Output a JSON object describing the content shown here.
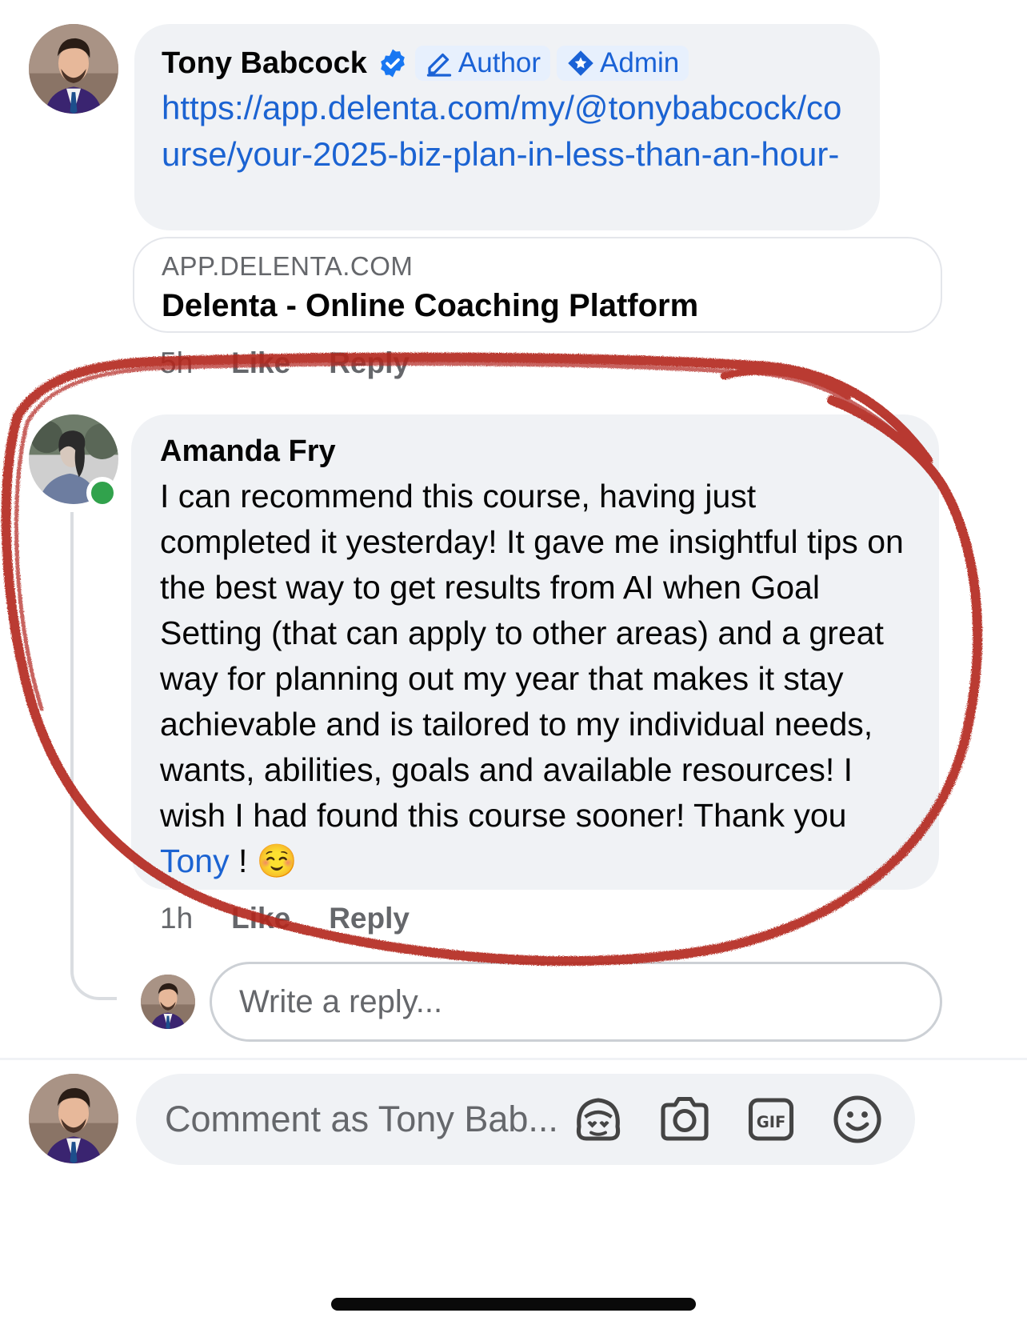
{
  "first_comment": {
    "author": "Tony Babcock",
    "badges": {
      "author": "Author",
      "admin": "Admin"
    },
    "link": "https://app.delenta.com/my/@tonybabcock/course/your-2025-biz-plan-in-less-than-an-hour-",
    "preview": {
      "domain": "APP.DELENTA.COM",
      "title": "Delenta - Online Coaching Platform"
    },
    "time": "5h",
    "like_label": "Like",
    "reply_label": "Reply"
  },
  "reply_comment": {
    "author": "Amanda Fry",
    "text_before_mention": "I can recommend this course, having just completed it yesterday! It gave me insightful tips on the best way to get results from AI when Goal Setting (that can apply to other areas) and a great way for planning out my year that makes it stay achievable and is tailored to my individual needs, wants, abilities, goals and available resources! I wish I had found this course sooner! Thank you ",
    "mention": "Tony",
    "text_after_mention": " ! ☺️",
    "time": "1h",
    "like_label": "Like",
    "reply_label": "Reply",
    "online": true
  },
  "reply_box": {
    "placeholder": "Write a reply..."
  },
  "composer": {
    "placeholder": "Comment as Tony Bab...",
    "tools": [
      "avatar-sticker-icon",
      "camera-icon",
      "gif-icon",
      "emoji-icon"
    ]
  },
  "colors": {
    "accent": "#1b63d2",
    "bubble": "#f0f2f5",
    "annotation": "#b3261e",
    "online": "#31a24c"
  }
}
